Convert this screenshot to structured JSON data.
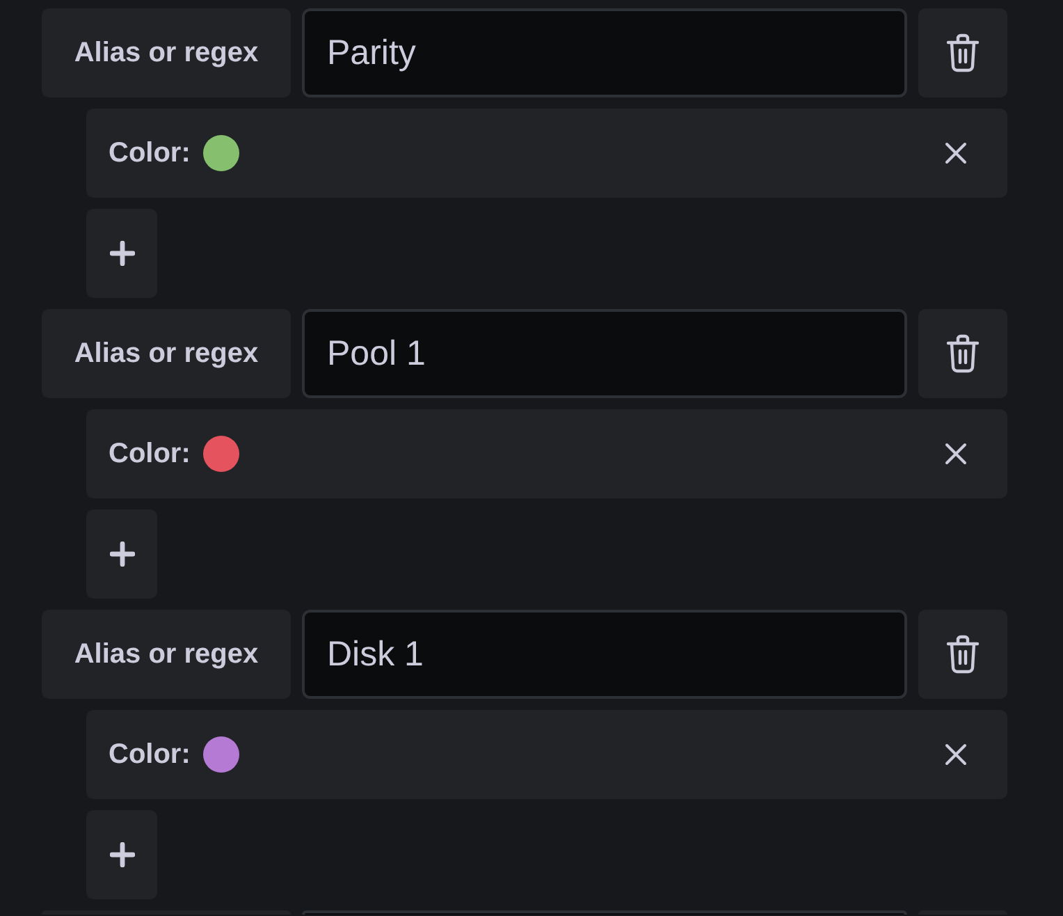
{
  "rows": [
    {
      "label": "Alias or regex",
      "value": "Parity",
      "overrides": [
        {
          "label": "Color:",
          "color": "#86c06f"
        }
      ]
    },
    {
      "label": "Alias or regex",
      "value": "Pool 1",
      "overrides": [
        {
          "label": "Color:",
          "color": "#e5535f"
        }
      ]
    },
    {
      "label": "Alias or regex",
      "value": "Disk 1",
      "overrides": [
        {
          "label": "Color:",
          "color": "#b57bd4"
        }
      ]
    }
  ],
  "more_rows_below": true
}
